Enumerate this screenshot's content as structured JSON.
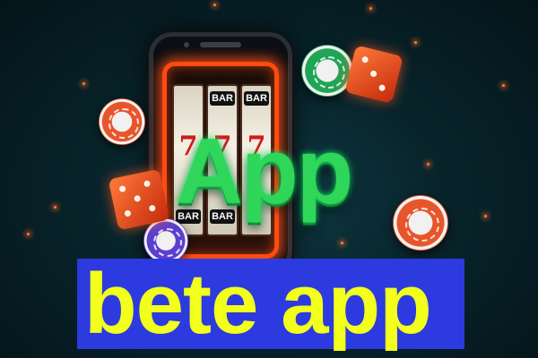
{
  "scene": {
    "headline": "App",
    "banner_text": "bete app",
    "reel_symbols": {
      "bar": "BAR",
      "seven": "7"
    }
  },
  "colors": {
    "background": "#08242b",
    "headline": "#2fd65a",
    "banner_bg": "#2c3ae0",
    "banner_text": "#f2ff1a",
    "neon_frame": "#ff4a12"
  },
  "icons": [
    "phone-icon",
    "slot-reel-icon",
    "poker-chip-icon",
    "dice-icon"
  ]
}
